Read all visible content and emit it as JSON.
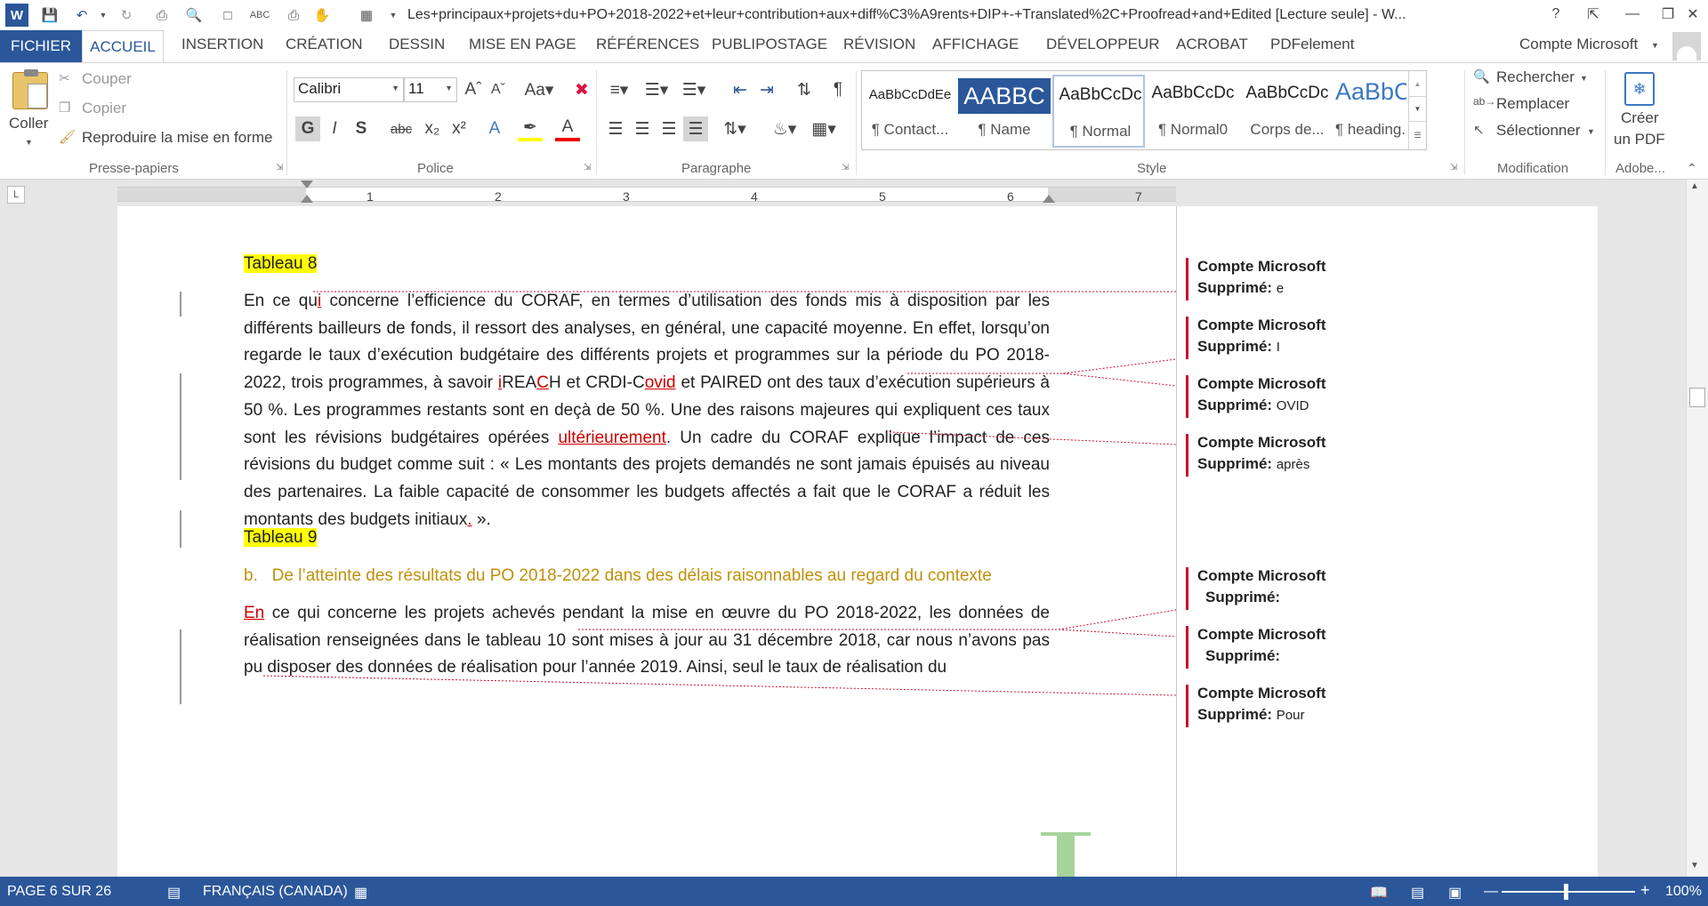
{
  "window": {
    "title": "Les+principaux+projets+du+PO+2018-2022+et+leur+contribution+aux+diff%C3%A9rents+DIP+-+Translated%2C+Proofread+and+Edited [Lecture seule] - W...",
    "help": "?",
    "account": "Compte Microsoft"
  },
  "tabs": {
    "file": "FICHIER",
    "home": "ACCUEIL",
    "others": [
      "INSERTION",
      "CRÉATION",
      "DESSIN",
      "MISE EN PAGE",
      "RÉFÉRENCES",
      "PUBLIPOSTAGE",
      "RÉVISION",
      "AFFICHAGE",
      "DÉVELOPPEUR",
      "ACROBAT",
      "PDFelement"
    ]
  },
  "ribbon": {
    "clipboard": {
      "paste": "Coller",
      "cut": "Couper",
      "copy": "Copier",
      "format_painter": "Reproduire la mise en forme",
      "group": "Presse-papiers"
    },
    "font": {
      "name": "Calibri",
      "size": "11",
      "group": "Police",
      "bold": "G",
      "italic": "I",
      "underline": "S",
      "strike": "abc"
    },
    "paragraph": {
      "group": "Paragraphe"
    },
    "styles": {
      "group": "Style",
      "items": [
        {
          "preview": "AaBbCcDdEe",
          "name": "¶ Contact..."
        },
        {
          "preview": "AABBC",
          "name": "¶ Name"
        },
        {
          "preview": "AaBbCcDc",
          "name": "¶ Normal"
        },
        {
          "preview": "AaBbCcDc",
          "name": "¶ Normal0"
        },
        {
          "preview": "AaBbCcDc",
          "name": "Corps de..."
        },
        {
          "preview": "AaBbCc",
          "name": "¶ heading..."
        }
      ]
    },
    "editing": {
      "group": "Modification",
      "find": "Rechercher",
      "replace": "Remplacer",
      "select": "Sélectionner"
    },
    "adobe": {
      "create_line1": "Créer",
      "create_line2": "un PDF",
      "group": "Adobe..."
    }
  },
  "ruler": {
    "numbers": [
      "1",
      "2",
      "3",
      "4",
      "5",
      "6",
      "7"
    ]
  },
  "document": {
    "tableau8": "Tableau 8",
    "p1": {
      "a": "En ce qu",
      "b": "i",
      "c": " concerne l’efficience du CORAF, en termes d’utilisation des fonds mis à disposition par les différents bailleurs de fonds, il ressort des analyses, en général, une capacité moyenne. En effet, lorsqu’on regarde le taux d’exécution budgétaire des différents projets et programmes sur la période du PO 2018-2022, trois programmes, à savoir ",
      "d": "i",
      "e": "REA",
      "f": "C",
      "g": "H et CRDI-C",
      "h": "ovid",
      "i": " et PAIRED ont des taux d’exécution supérieurs à 50 %. Les programmes restants sont en deçà de 50 %. Une des raisons majeures qui expliquent ces taux sont les révisions budgétaires opérées ",
      "j": "ultérieurement",
      "k": ". Un cadre du CORAF explique l’impact de ces révisions du budget comme suit : « Les montants des projets demandés ne sont jamais épuisés au niveau des partenaires. La faible capacité de consommer les budgets affectés a fait que le CORAF a réduit les montants des budgets initiaux",
      "l": ".",
      "m": " »."
    },
    "tableau9": "Tableau 9",
    "heading_b": "b.   De l’atteinte des résultats du PO 2018-2022 dans des délais raisonnables au regard du contexte",
    "p2": {
      "a": "En",
      "b": " ce qui concerne les projets achevés pendant la mise en œuvre du PO 2018-2022, les données de réalisation renseignées dans le tableau 10 sont mises à jour au 31 décembre 2018, car nous n’avons pas pu disposer des données de réalisation pour l’année 2019. Ainsi, seul le taux de réalisation du"
    }
  },
  "comments": [
    {
      "author": "Compte Microsoft",
      "label": "Supprimé:",
      "value": "e"
    },
    {
      "author": "Compte Microsoft",
      "label": "Supprimé:",
      "value": "I"
    },
    {
      "author": "Compte Microsoft",
      "label": "Supprimé:",
      "value": "OVID"
    },
    {
      "author": "Compte Microsoft",
      "label": "Supprimé:",
      "value": "après"
    },
    {
      "author": "Compte Microsoft",
      "label": "Supprimé:",
      "value": ""
    },
    {
      "author": "Compte Microsoft",
      "label": "Supprimé:",
      "value": ""
    },
    {
      "author": "Compte Microsoft",
      "label": "Supprimé:",
      "value": "Pour"
    }
  ],
  "status": {
    "page": "PAGE 6 SUR 26",
    "language": "FRANÇAIS (CANADA)",
    "zoom": "100%"
  },
  "colors": {
    "accent": "#2b579a",
    "highlight": "#ffff00",
    "revision": "#c8102e",
    "heading": "#c0900a"
  }
}
